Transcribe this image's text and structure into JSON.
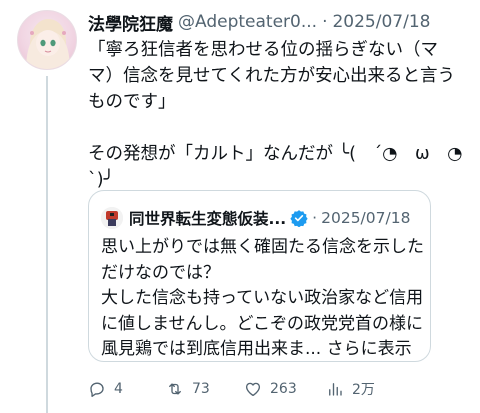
{
  "post": {
    "display_name": "法學院狂魔",
    "handle": "@Adepteater0...",
    "separator": "·",
    "date": "2025/07/18",
    "text_lines": [
      "「寧ろ狂信者を思わせる位の揺らぎない（マ",
      "マ）信念を見せてくれた方が安心出来ると言う",
      "ものです」",
      "",
      "その発想が「カルト」なんだが ╰(　´◔　ω　◔",
      "`)╯"
    ]
  },
  "quote": {
    "display_name": "同世界転生変態仮装...",
    "separator": "·",
    "date": "2025/07/18",
    "text_lines": [
      "思い上がりでは無く確固たる信念を示した",
      "だけなのでは？",
      "大した信念も持っていない政治家など信用",
      "に値しませんし。どこぞの政党党首の様に",
      "風見鶏では到底信用出来ま..."
    ],
    "show_more": "さらに表示"
  },
  "actions": {
    "replies": "4",
    "reposts": "73",
    "likes": "263",
    "views": "2万"
  },
  "colors": {
    "text": "#0f1419",
    "secondary": "#536471",
    "border": "#cfd9de",
    "verified": "#1d9bf0"
  },
  "icons": [
    "reply-icon",
    "repost-icon",
    "like-icon",
    "views-icon",
    "verified-badge-icon"
  ]
}
